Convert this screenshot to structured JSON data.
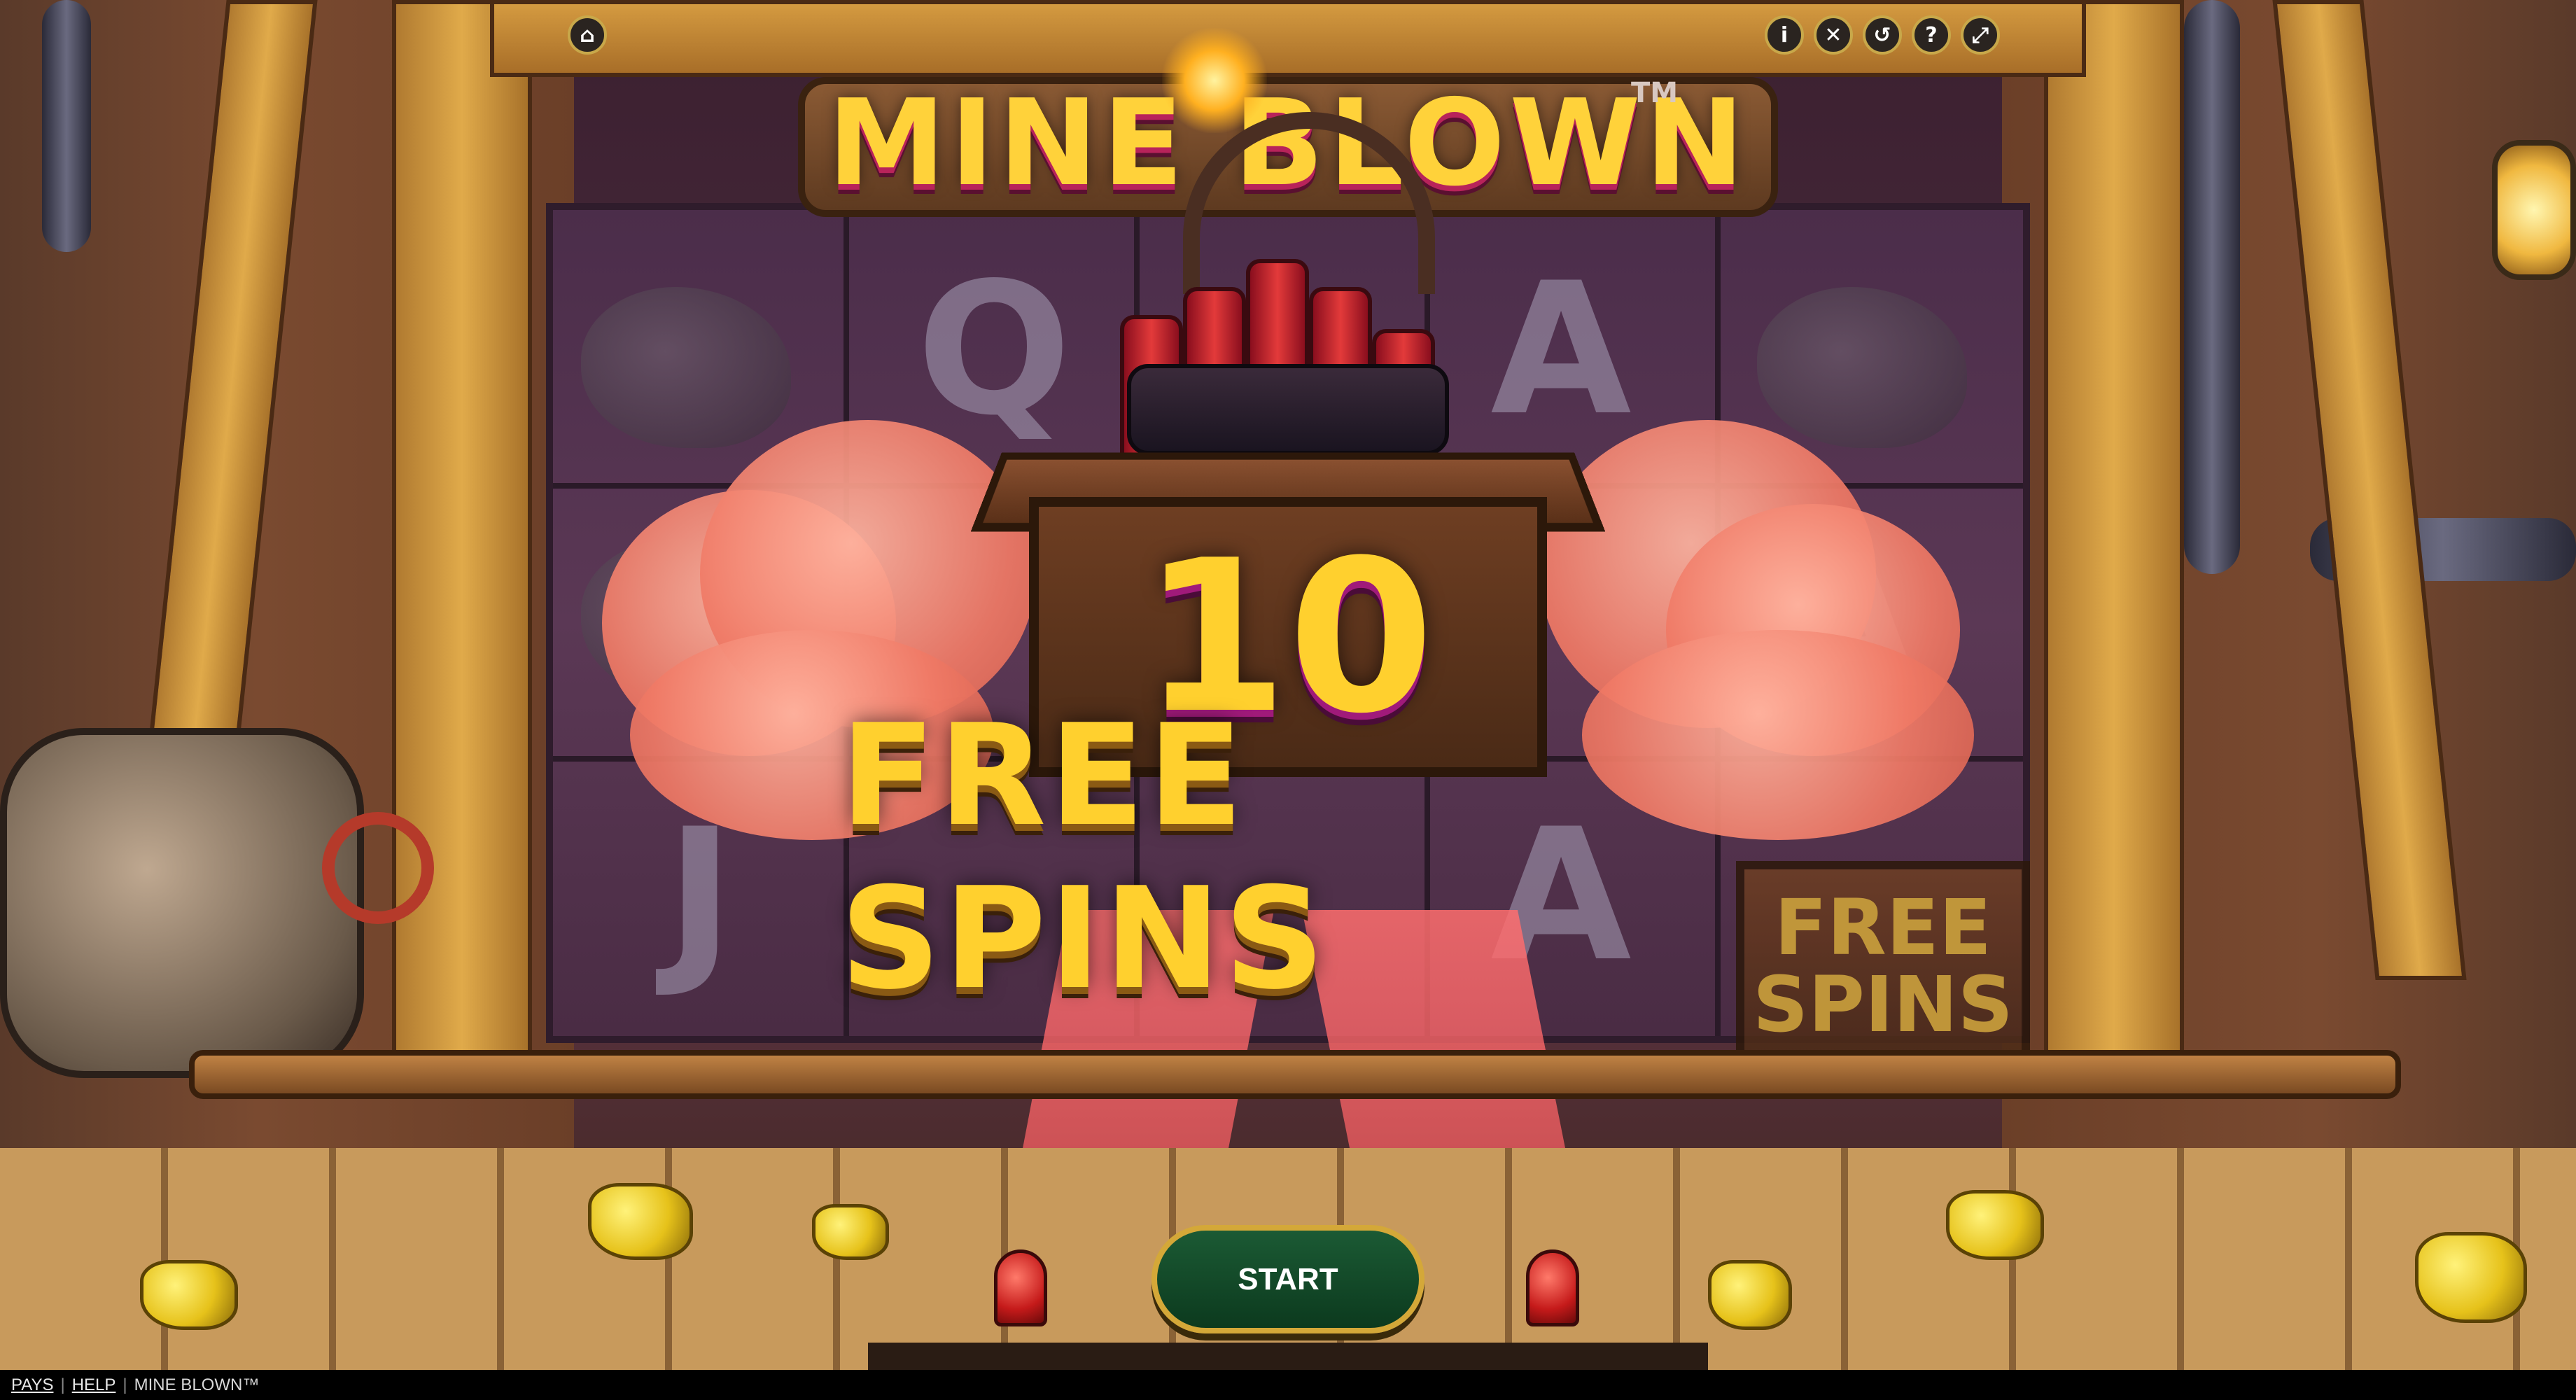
{
  "game": {
    "logo_text": "MINE BLOWN",
    "trademark": "TM"
  },
  "top_controls": [
    {
      "name": "home-icon",
      "glyph": "⌂"
    },
    {
      "name": "info-icon",
      "glyph": "i"
    },
    {
      "name": "mute-icon",
      "glyph": "✕"
    },
    {
      "name": "history-icon",
      "glyph": "↺"
    },
    {
      "name": "help-icon",
      "glyph": "?"
    },
    {
      "name": "fullscreen-icon",
      "glyph": "⤢"
    }
  ],
  "award": {
    "count": "10",
    "label": "FREE SPINS"
  },
  "reel_symbols": {
    "r1": "Q",
    "r2": "A",
    "r3": "A",
    "r4": "J",
    "r5": "A",
    "free_spins_symbol": "FREE SPINS"
  },
  "start_button": {
    "label": "START"
  },
  "bottom_bar": {
    "pays": "PAYS",
    "help": "HELP",
    "title": "MINE BLOWN™"
  },
  "colors": {
    "gold_text": "#ffd02e",
    "start_green": "#1b5a34",
    "cloud": "#f07a66",
    "ray": "#ff6e6e"
  }
}
